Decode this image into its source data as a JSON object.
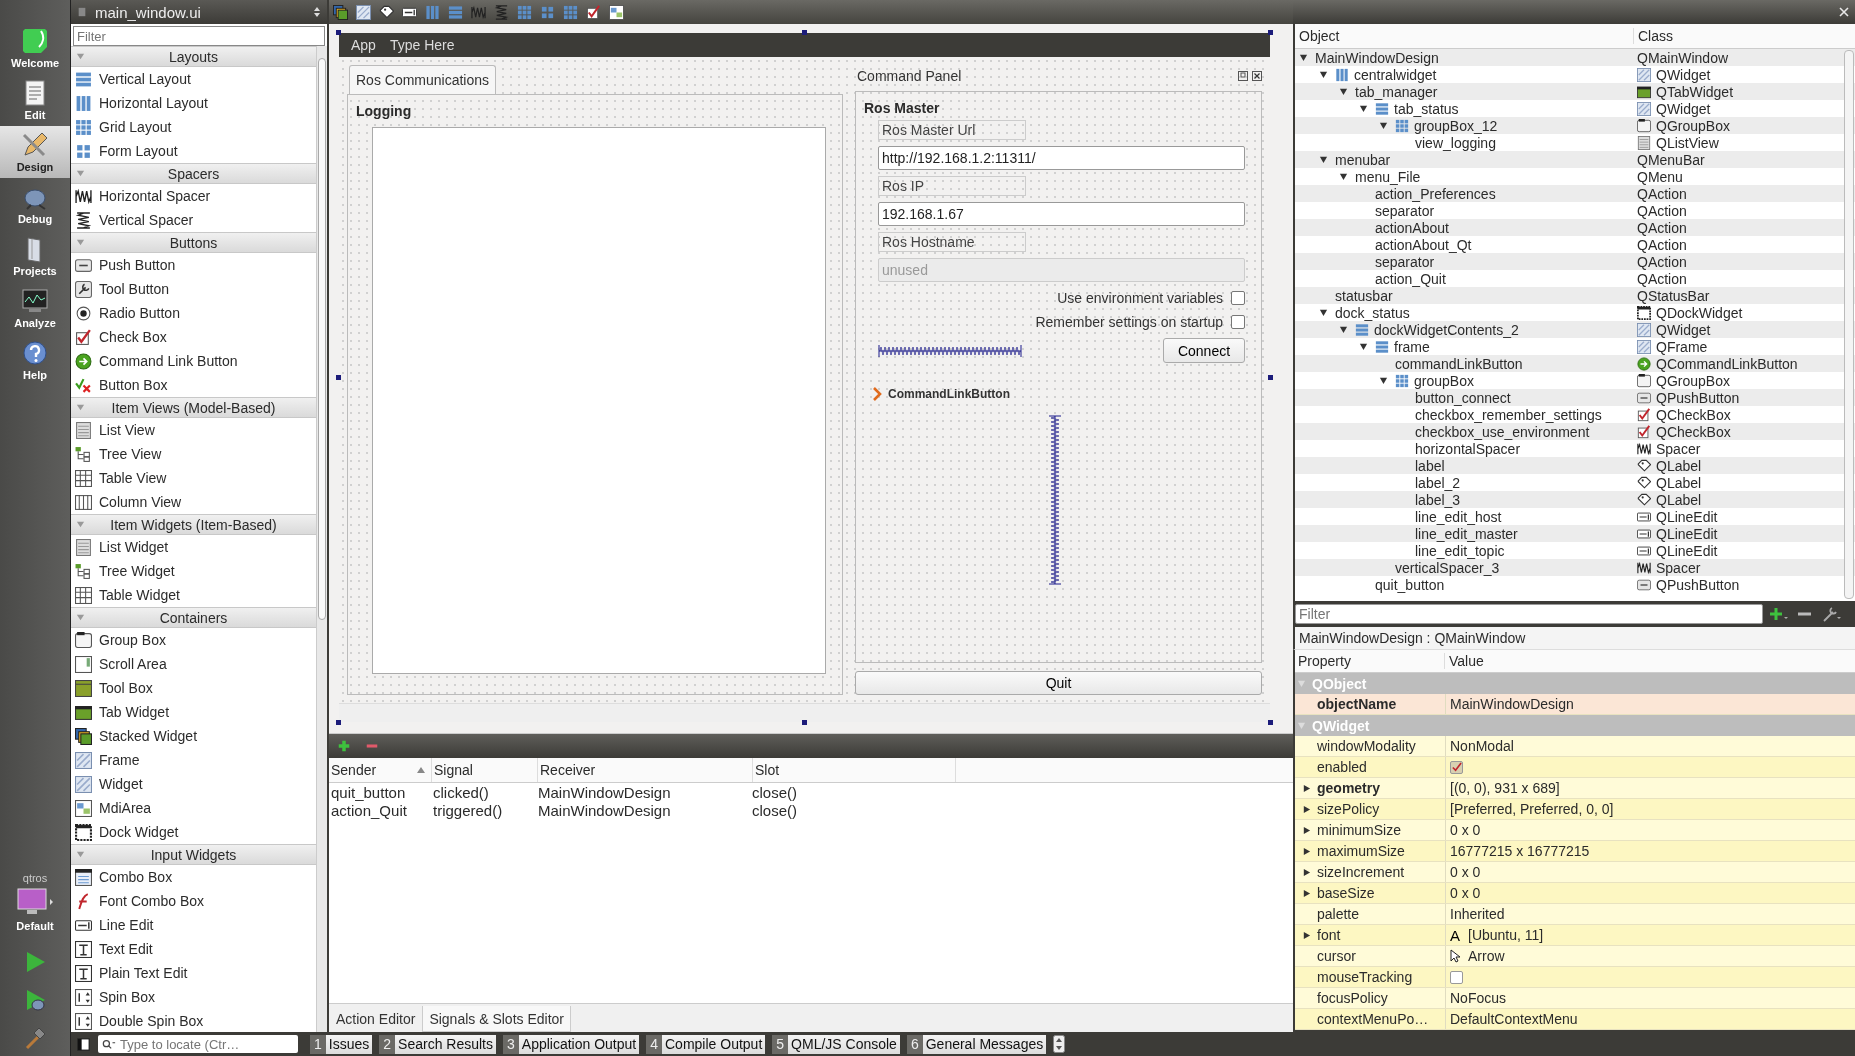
{
  "mode_bar": {
    "modes": [
      {
        "label": "Welcome",
        "selected": false
      },
      {
        "label": "Edit",
        "selected": false
      },
      {
        "label": "Design",
        "selected": true
      },
      {
        "label": "Debug",
        "selected": false
      },
      {
        "label": "Projects",
        "selected": false
      },
      {
        "label": "Analyze",
        "selected": false
      },
      {
        "label": "Help",
        "selected": false
      }
    ],
    "kit": {
      "project": "qtros",
      "config": "Default"
    }
  },
  "widget_box": {
    "document": "main_window.ui",
    "filter": {
      "placeholder": "Filter"
    },
    "categories": [
      {
        "title": "Layouts",
        "expanded": true,
        "items": [
          {
            "label": "Vertical Layout"
          },
          {
            "label": "Horizontal Layout"
          },
          {
            "label": "Grid Layout"
          },
          {
            "label": "Form Layout"
          }
        ]
      },
      {
        "title": "Spacers",
        "expanded": true,
        "items": [
          {
            "label": "Horizontal Spacer"
          },
          {
            "label": "Vertical Spacer"
          }
        ]
      },
      {
        "title": "Buttons",
        "expanded": true,
        "items": [
          {
            "label": "Push Button"
          },
          {
            "label": "Tool Button"
          },
          {
            "label": "Radio Button"
          },
          {
            "label": "Check Box"
          },
          {
            "label": "Command Link Button"
          },
          {
            "label": "Button Box"
          }
        ]
      },
      {
        "title": "Item Views (Model-Based)",
        "expanded": true,
        "items": [
          {
            "label": "List View"
          },
          {
            "label": "Tree View"
          },
          {
            "label": "Table View"
          },
          {
            "label": "Column View"
          }
        ]
      },
      {
        "title": "Item Widgets (Item-Based)",
        "expanded": true,
        "items": [
          {
            "label": "List Widget"
          },
          {
            "label": "Tree Widget"
          },
          {
            "label": "Table Widget"
          }
        ]
      },
      {
        "title": "Containers",
        "expanded": true,
        "items": [
          {
            "label": "Group Box"
          },
          {
            "label": "Scroll Area"
          },
          {
            "label": "Tool Box"
          },
          {
            "label": "Tab Widget"
          },
          {
            "label": "Stacked Widget"
          },
          {
            "label": "Frame"
          },
          {
            "label": "Widget"
          },
          {
            "label": "MdiArea"
          },
          {
            "label": "Dock Widget"
          }
        ]
      },
      {
        "title": "Input Widgets",
        "expanded": true,
        "items": [
          {
            "label": "Combo Box"
          },
          {
            "label": "Font Combo Box"
          },
          {
            "label": "Line Edit"
          },
          {
            "label": "Text Edit"
          },
          {
            "label": "Plain Text Edit"
          },
          {
            "label": "Spin Box"
          },
          {
            "label": "Double Spin Box"
          }
        ]
      }
    ]
  },
  "form": {
    "menus": [
      "App",
      "Type Here"
    ],
    "tabs": [
      {
        "label": "Ros Communications",
        "selected": true
      }
    ],
    "logging_title": "Logging",
    "dock": {
      "title": "Command Panel",
      "group_title": "Ros Master",
      "fields": [
        {
          "label": "Ros Master Url",
          "value": "http://192.168.1.2:11311/",
          "disabled": false
        },
        {
          "label": "Ros IP",
          "value": "192.168.1.67",
          "disabled": false
        },
        {
          "label": "Ros Hostname",
          "value": "unused",
          "disabled": true
        }
      ],
      "checkboxes": [
        {
          "label": "Use environment variables",
          "checked": false
        },
        {
          "label": "Remember settings on startup",
          "checked": false
        }
      ],
      "connect": "Connect",
      "command_link": "CommandLinkButton"
    },
    "quit": "Quit"
  },
  "signals_editor": {
    "columns": [
      "Sender",
      "Signal",
      "Receiver",
      "Slot"
    ],
    "rows": [
      [
        "quit_button",
        "clicked()",
        "MainWindowDesign",
        "close()"
      ],
      [
        "action_Quit",
        "triggered()",
        "MainWindowDesign",
        "close()"
      ]
    ],
    "tabs": [
      {
        "label": "Action Editor",
        "selected": false
      },
      {
        "label": "Signals & Slots Editor",
        "selected": true
      }
    ]
  },
  "object_inspector": {
    "columns": [
      "Object",
      "Class"
    ],
    "tree": [
      {
        "name": "MainWindowDesign",
        "class": "QMainWindow",
        "expanded": true,
        "children": [
          {
            "name": "centralwidget",
            "class": "QWidget",
            "expanded": true,
            "children": [
              {
                "name": "tab_manager",
                "class": "QTabWidget",
                "expanded": true,
                "children": [
                  {
                    "name": "tab_status",
                    "class": "QWidget",
                    "expanded": true,
                    "children": [
                      {
                        "name": "groupBox_12",
                        "class": "QGroupBox",
                        "expanded": true,
                        "children": [
                          {
                            "name": "view_logging",
                            "class": "QListView"
                          }
                        ]
                      }
                    ]
                  }
                ]
              }
            ]
          },
          {
            "name": "menubar",
            "class": "QMenuBar",
            "expanded": true,
            "children": [
              {
                "name": "menu_File",
                "class": "QMenu",
                "expanded": true,
                "children": [
                  {
                    "name": "action_Preferences",
                    "class": "QAction"
                  },
                  {
                    "name": "separator",
                    "class": "QAction"
                  },
                  {
                    "name": "actionAbout",
                    "class": "QAction"
                  },
                  {
                    "name": "actionAbout_Qt",
                    "class": "QAction"
                  },
                  {
                    "name": "separator",
                    "class": "QAction"
                  },
                  {
                    "name": "action_Quit",
                    "class": "QAction"
                  }
                ]
              }
            ]
          },
          {
            "name": "statusbar",
            "class": "QStatusBar"
          },
          {
            "name": "dock_status",
            "class": "QDockWidget",
            "expanded": true,
            "children": [
              {
                "name": "dockWidgetContents_2",
                "class": "QWidget",
                "expanded": true,
                "children": [
                  {
                    "name": "frame",
                    "class": "QFrame",
                    "expanded": true,
                    "children": [
                      {
                        "name": "commandLinkButton",
                        "class": "QCommandLinkButton"
                      },
                      {
                        "name": "groupBox",
                        "class": "QGroupBox",
                        "expanded": true,
                        "children": [
                          {
                            "name": "button_connect",
                            "class": "QPushButton"
                          },
                          {
                            "name": "checkbox_remember_settings",
                            "class": "QCheckBox"
                          },
                          {
                            "name": "checkbox_use_environment",
                            "class": "QCheckBox"
                          },
                          {
                            "name": "horizontalSpacer",
                            "class": "Spacer"
                          },
                          {
                            "name": "label",
                            "class": "QLabel"
                          },
                          {
                            "name": "label_2",
                            "class": "QLabel"
                          },
                          {
                            "name": "label_3",
                            "class": "QLabel"
                          },
                          {
                            "name": "line_edit_host",
                            "class": "QLineEdit"
                          },
                          {
                            "name": "line_edit_master",
                            "class": "QLineEdit"
                          },
                          {
                            "name": "line_edit_topic",
                            "class": "QLineEdit"
                          }
                        ]
                      },
                      {
                        "name": "verticalSpacer_3",
                        "class": "Spacer"
                      }
                    ]
                  },
                  {
                    "name": "quit_button",
                    "class": "QPushButton"
                  }
                ]
              }
            ]
          }
        ]
      }
    ]
  },
  "property_editor": {
    "filter": {
      "placeholder": "Filter"
    },
    "object": "MainWindowDesign : QMainWindow",
    "columns": [
      "Property",
      "Value"
    ],
    "rows": [
      {
        "kind": "group",
        "name": "QObject",
        "expanded": true
      },
      {
        "kind": "text",
        "name": "objectName",
        "value": "MainWindowDesign",
        "bold": true,
        "expandable": false
      },
      {
        "kind": "group",
        "name": "QWidget",
        "expanded": true
      },
      {
        "kind": "text",
        "name": "windowModality",
        "value": "NonModal",
        "bold": false,
        "expandable": false
      },
      {
        "kind": "checkbox",
        "name": "enabled",
        "checked": true
      },
      {
        "kind": "text",
        "name": "geometry",
        "value": "[(0, 0), 931 x 689]",
        "bold": true,
        "expandable": true
      },
      {
        "kind": "text",
        "name": "sizePolicy",
        "value": "[Preferred, Preferred, 0, 0]",
        "bold": false,
        "expandable": true
      },
      {
        "kind": "text",
        "name": "minimumSize",
        "value": "0 x 0",
        "bold": false,
        "expandable": true
      },
      {
        "kind": "text",
        "name": "maximumSize",
        "value": "16777215 x 16777215",
        "bold": false,
        "expandable": true
      },
      {
        "kind": "text",
        "name": "sizeIncrement",
        "value": "0 x 0",
        "bold": false,
        "expandable": true
      },
      {
        "kind": "text",
        "name": "baseSize",
        "value": "0 x 0",
        "bold": false,
        "expandable": true
      },
      {
        "kind": "text",
        "name": "palette",
        "value": "Inherited",
        "bold": false,
        "expandable": false
      },
      {
        "kind": "font",
        "name": "font",
        "glyph": "A",
        "value": "[Ubuntu, 11]",
        "expandable": true
      },
      {
        "kind": "cursor",
        "name": "cursor",
        "value": "Arrow"
      },
      {
        "kind": "checkbox",
        "name": "mouseTracking",
        "checked": false
      },
      {
        "kind": "text",
        "name": "focusPolicy",
        "value": "NoFocus",
        "bold": false,
        "expandable": false
      },
      {
        "kind": "text",
        "name": "contextMenuPo…",
        "value": "DefaultContextMenu",
        "bold": false,
        "expandable": false
      }
    ]
  },
  "status_bar": {
    "locator": {
      "placeholder": "Type to locate (Ctr…"
    },
    "panes": [
      {
        "number": "1",
        "label": "Issues"
      },
      {
        "number": "2",
        "label": "Search Results"
      },
      {
        "number": "3",
        "label": "Application Output"
      },
      {
        "number": "4",
        "label": "Compile Output"
      },
      {
        "number": "5",
        "label": "QML/JS Console"
      },
      {
        "number": "6",
        "label": "General Messages"
      }
    ]
  }
}
